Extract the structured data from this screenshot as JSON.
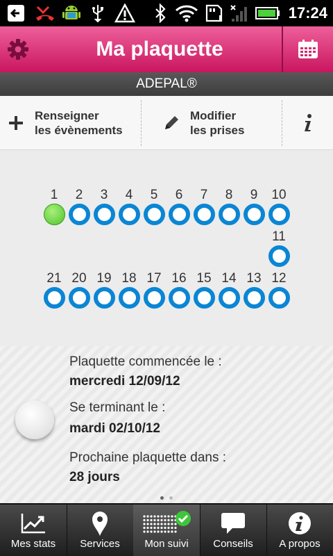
{
  "status_bar": {
    "time": "17:24"
  },
  "header": {
    "title": "Ma plaquette",
    "subtitle": "ADEPAL®"
  },
  "actions": [
    {
      "label_line1": "Renseigner",
      "label_line2": "les évènements",
      "icon": "plus-icon"
    },
    {
      "label_line1": "Modifier",
      "label_line2": "les prises",
      "icon": "pencil-icon"
    },
    {
      "icon": "info-icon"
    }
  ],
  "pack": {
    "taken_days": [
      1
    ],
    "row_top": [
      "1",
      "2",
      "3",
      "4",
      "5",
      "6",
      "7",
      "8",
      "9",
      "10"
    ],
    "row_mid": [
      "11"
    ],
    "row_bottom": [
      "21",
      "20",
      "19",
      "18",
      "17",
      "16",
      "15",
      "14",
      "13",
      "12"
    ]
  },
  "info": {
    "started_label": "Plaquette commencée le :",
    "started_value": "mercredi 12/09/12",
    "ending_label": "Se terminant le :",
    "ending_value": "mardi 02/10/12",
    "next_label": "Prochaine plaquette dans :",
    "next_value": "28 jours"
  },
  "pager": {
    "pages": 2,
    "active": 0
  },
  "tabs": [
    {
      "label": "Mes stats",
      "icon": "chart-icon"
    },
    {
      "label": "Services",
      "icon": "map-pin-icon"
    },
    {
      "label": "Mon suivi",
      "icon": "pill-dots-icon",
      "active": true
    },
    {
      "label": "Conseils",
      "icon": "speech-bubble-icon"
    },
    {
      "label": "A propos",
      "icon": "info-circle-icon"
    }
  ],
  "colors": {
    "accent": "#e03b80",
    "pill_ring": "#0a86d4",
    "taken": "#5fcf35"
  }
}
